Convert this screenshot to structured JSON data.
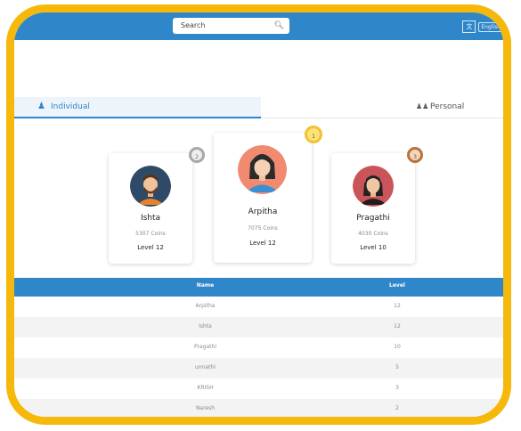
{
  "header": {
    "search_placeholder": "Search",
    "language_label": "English"
  },
  "tabs": [
    {
      "label": "Individual",
      "active": true
    },
    {
      "label": "Personal",
      "active": false
    }
  ],
  "podium": [
    {
      "rank": "2",
      "name": "Ishta",
      "coins": "5307 Coins",
      "level": "Level 12"
    },
    {
      "rank": "1",
      "name": "Arpitha",
      "coins": "7075 Coins",
      "level": "Level 12"
    },
    {
      "rank": "3",
      "name": "Pragathi",
      "coins": "4030 Coins",
      "level": "Level 10"
    }
  ],
  "table": {
    "headers": {
      "name": "Name",
      "level": "Level"
    },
    "rows": [
      {
        "name": "Arpitha",
        "level": "12"
      },
      {
        "name": "Ishta",
        "level": "12"
      },
      {
        "name": "Pragathi",
        "level": "10"
      },
      {
        "name": "unnathi",
        "level": "5"
      },
      {
        "name": "KRISH",
        "level": "3"
      },
      {
        "name": "Naresh",
        "level": "2"
      }
    ]
  },
  "colors": {
    "frame": "#f5b80b",
    "primary": "#2f86c9",
    "gold": "#f1c232",
    "silver": "#a8a8a8",
    "bronze": "#b8733a"
  }
}
